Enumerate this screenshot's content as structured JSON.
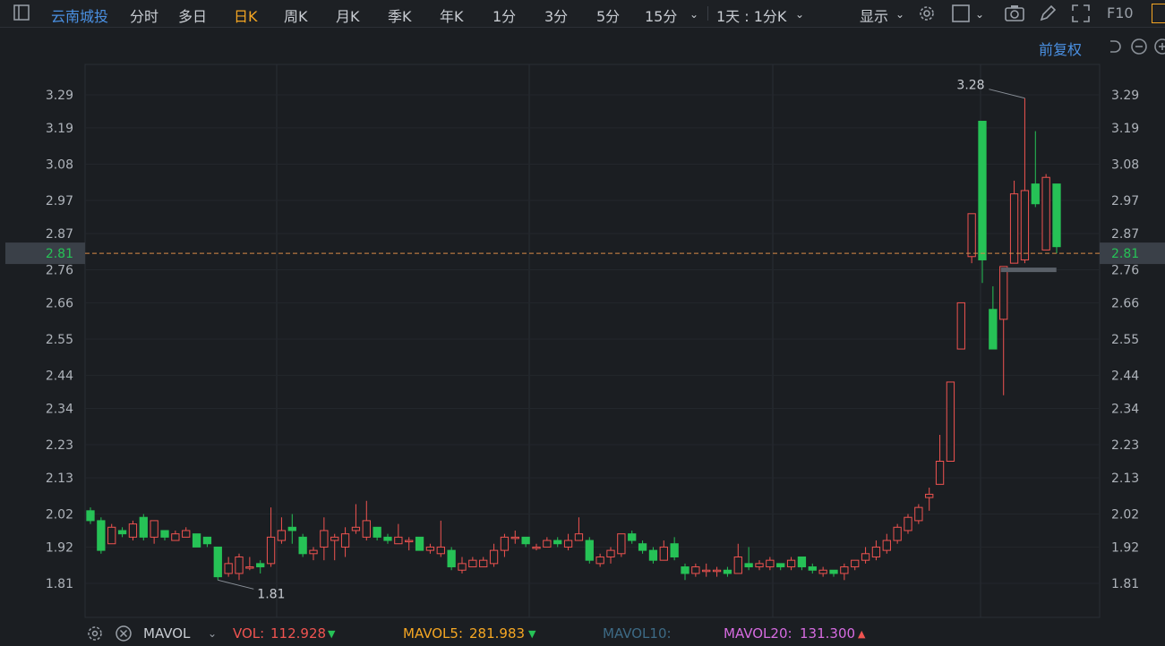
{
  "toolbar": {
    "stock_name": "云南城投",
    "periods": [
      "分时",
      "多日",
      "日K",
      "周K",
      "月K",
      "季K",
      "年K",
      "1分",
      "3分",
      "5分",
      "15分"
    ],
    "active_period": "日K",
    "multi_period": "1天 : 1分K",
    "display_label": "显示",
    "f10_label": "F10"
  },
  "adjust_label": "前复权",
  "current_price_label": "2.81",
  "chart_data": {
    "type": "candlestick",
    "y_ticks": [
      "3.29",
      "3.19",
      "3.08",
      "2.97",
      "2.87",
      "2.76",
      "2.66",
      "2.55",
      "2.44",
      "2.34",
      "2.23",
      "2.13",
      "2.02",
      "1.92",
      "1.81"
    ],
    "ylim": [
      1.76,
      3.35
    ],
    "current_price": 2.81,
    "annotations": {
      "high": "3.28",
      "low": "1.81"
    },
    "candles": [
      [
        2.03,
        2.0,
        2.04,
        1.99
      ],
      [
        2.0,
        1.91,
        2.01,
        1.9
      ],
      [
        1.93,
        1.98,
        1.99,
        1.93
      ],
      [
        1.97,
        1.96,
        1.98,
        1.95
      ],
      [
        1.95,
        1.99,
        2.0,
        1.94
      ],
      [
        2.01,
        1.95,
        2.02,
        1.94
      ],
      [
        1.95,
        2.0,
        2.0,
        1.93
      ],
      [
        1.97,
        1.95,
        1.97,
        1.94
      ],
      [
        1.94,
        1.96,
        1.97,
        1.94
      ],
      [
        1.95,
        1.97,
        1.98,
        1.95
      ],
      [
        1.96,
        1.92,
        1.96,
        1.92
      ],
      [
        1.95,
        1.93,
        1.95,
        1.92
      ],
      [
        1.92,
        1.83,
        1.92,
        1.82
      ],
      [
        1.84,
        1.87,
        1.89,
        1.83
      ],
      [
        1.84,
        1.89,
        1.9,
        1.82
      ],
      [
        1.86,
        1.86,
        1.89,
        1.85
      ],
      [
        1.87,
        1.86,
        1.88,
        1.84
      ],
      [
        1.87,
        1.95,
        2.04,
        1.86
      ],
      [
        1.94,
        1.97,
        2.01,
        1.93
      ],
      [
        1.98,
        1.97,
        2.02,
        1.93
      ],
      [
        1.95,
        1.9,
        1.96,
        1.89
      ],
      [
        1.9,
        1.91,
        1.92,
        1.88
      ],
      [
        1.92,
        1.97,
        2.01,
        1.88
      ],
      [
        1.94,
        1.95,
        1.96,
        1.88
      ],
      [
        1.92,
        1.96,
        1.98,
        1.89
      ],
      [
        1.97,
        1.98,
        2.05,
        1.96
      ],
      [
        1.95,
        2.0,
        2.06,
        1.94
      ],
      [
        1.98,
        1.95,
        1.98,
        1.94
      ],
      [
        1.95,
        1.94,
        1.96,
        1.93
      ],
      [
        1.93,
        1.95,
        1.99,
        1.93
      ],
      [
        1.94,
        1.94,
        1.95,
        1.91
      ],
      [
        1.95,
        1.91,
        1.95,
        1.91
      ],
      [
        1.91,
        1.92,
        1.93,
        1.9
      ],
      [
        1.9,
        1.92,
        2.0,
        1.89
      ],
      [
        1.91,
        1.86,
        1.92,
        1.85
      ],
      [
        1.85,
        1.87,
        1.89,
        1.84
      ],
      [
        1.86,
        1.88,
        1.89,
        1.86
      ],
      [
        1.86,
        1.88,
        1.89,
        1.86
      ],
      [
        1.87,
        1.91,
        1.93,
        1.86
      ],
      [
        1.91,
        1.95,
        1.96,
        1.89
      ],
      [
        1.95,
        1.95,
        1.97,
        1.93
      ],
      [
        1.95,
        1.93,
        1.95,
        1.92
      ],
      [
        1.92,
        1.92,
        1.93,
        1.91
      ],
      [
        1.92,
        1.94,
        1.95,
        1.92
      ],
      [
        1.94,
        1.93,
        1.95,
        1.92
      ],
      [
        1.92,
        1.94,
        1.96,
        1.91
      ],
      [
        1.94,
        1.96,
        2.01,
        1.94
      ],
      [
        1.94,
        1.88,
        1.95,
        1.87
      ],
      [
        1.87,
        1.89,
        1.9,
        1.86
      ],
      [
        1.89,
        1.91,
        1.92,
        1.87
      ],
      [
        1.9,
        1.96,
        1.96,
        1.89
      ],
      [
        1.96,
        1.94,
        1.97,
        1.93
      ],
      [
        1.93,
        1.91,
        1.94,
        1.9
      ],
      [
        1.91,
        1.88,
        1.92,
        1.87
      ],
      [
        1.88,
        1.92,
        1.94,
        1.88
      ],
      [
        1.93,
        1.89,
        1.95,
        1.88
      ],
      [
        1.86,
        1.84,
        1.87,
        1.82
      ],
      [
        1.84,
        1.86,
        1.87,
        1.83
      ],
      [
        1.85,
        1.85,
        1.87,
        1.83
      ],
      [
        1.85,
        1.85,
        1.86,
        1.83
      ],
      [
        1.85,
        1.84,
        1.86,
        1.83
      ],
      [
        1.84,
        1.89,
        1.93,
        1.84
      ],
      [
        1.87,
        1.86,
        1.92,
        1.85
      ],
      [
        1.86,
        1.87,
        1.88,
        1.85
      ],
      [
        1.86,
        1.88,
        1.89,
        1.85
      ],
      [
        1.87,
        1.86,
        1.87,
        1.85
      ],
      [
        1.86,
        1.88,
        1.89,
        1.85
      ],
      [
        1.89,
        1.86,
        1.89,
        1.85
      ],
      [
        1.86,
        1.85,
        1.87,
        1.84
      ],
      [
        1.84,
        1.85,
        1.86,
        1.83
      ],
      [
        1.85,
        1.84,
        1.85,
        1.83
      ],
      [
        1.84,
        1.86,
        1.87,
        1.82
      ],
      [
        1.86,
        1.88,
        1.88,
        1.85
      ],
      [
        1.88,
        1.9,
        1.92,
        1.87
      ],
      [
        1.89,
        1.92,
        1.94,
        1.88
      ],
      [
        1.91,
        1.94,
        1.96,
        1.9
      ],
      [
        1.94,
        1.98,
        1.99,
        1.93
      ],
      [
        1.97,
        2.01,
        2.02,
        1.96
      ],
      [
        2.0,
        2.04,
        2.05,
        1.99
      ],
      [
        2.07,
        2.08,
        2.1,
        2.03
      ],
      [
        2.11,
        2.18,
        2.26,
        2.11
      ],
      [
        2.18,
        2.42,
        2.42,
        2.18
      ],
      [
        2.52,
        2.66,
        2.66,
        2.52
      ],
      [
        2.8,
        2.93,
        2.93,
        2.78
      ],
      [
        3.21,
        2.79,
        3.21,
        2.72
      ],
      [
        2.64,
        2.52,
        2.71,
        2.52
      ],
      [
        2.61,
        2.77,
        2.77,
        2.38
      ],
      [
        2.78,
        2.99,
        3.03,
        2.78
      ],
      [
        2.79,
        3.0,
        3.28,
        2.78
      ],
      [
        3.02,
        2.96,
        3.18,
        2.95
      ],
      [
        2.82,
        3.04,
        3.05,
        2.82
      ],
      [
        3.02,
        2.83,
        3.02,
        2.81
      ]
    ]
  },
  "indicators": {
    "name": "MAVOL",
    "vol_label": "VOL:",
    "vol_value": "112.928",
    "mavol5_label": "MAVOL5:",
    "mavol5_value": "281.983",
    "mavol10_label": "MAVOL10:",
    "mavol20_label": "MAVOL20:",
    "mavol20_value": "131.300"
  },
  "colors": {
    "up": "#ef5350",
    "down": "#26c256",
    "accent": "#f5a623",
    "link": "#4a90e2",
    "grid": "#2a2e34",
    "bg": "#1b1e22"
  }
}
